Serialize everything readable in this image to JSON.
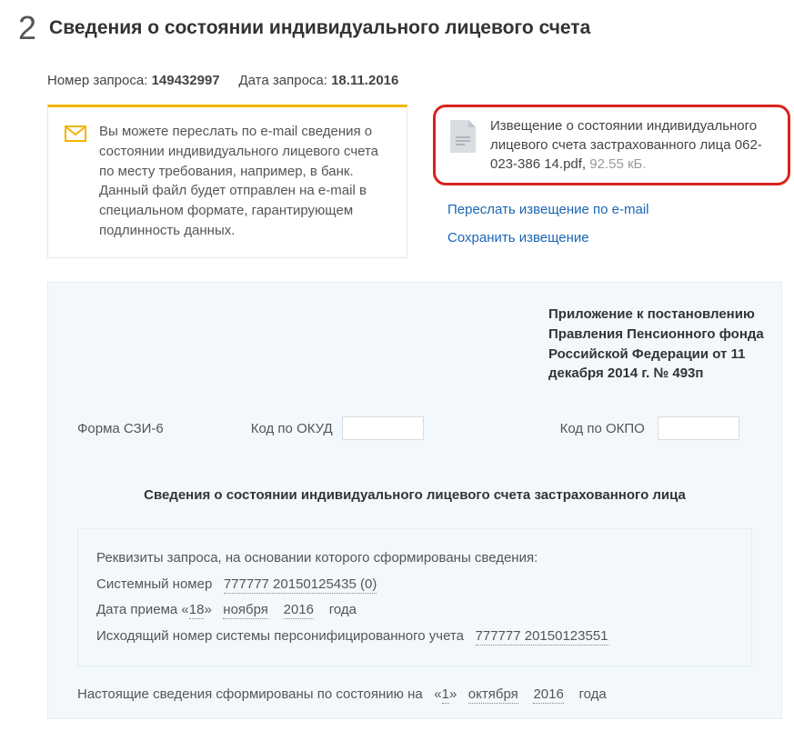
{
  "step_number": "2",
  "title": "Сведения о состоянии индивидуального лицевого счета",
  "meta": {
    "request_number_label": "Номер запроса:",
    "request_number": "149432997",
    "request_date_label": "Дата запроса:",
    "request_date": "18.11.2016"
  },
  "info_card": "Вы можете переслать по e-mail сведения о состоянии индивидуального лицевого счета по месту требования, например, в банк. Данный файл будет отправлен на e-mail в специальном формате, гарантирующем подлинность данных.",
  "file": {
    "title_pre": "Извещение о состоянии индивидуального лицевого счета застрахованного лица 062-023-386 14.pdf",
    "size": "92.55 кБ."
  },
  "links": {
    "forward": "Переслать извещение по e-mail",
    "save": "Сохранить извещение"
  },
  "doc": {
    "regulation": "Приложение к постановлению Правления Пенсионного фонда Российской Федерации от 11 декабря 2014 г. № 493п",
    "form_label": "Форма СЗИ-6",
    "okud_label": "Код по ОКУД",
    "okpo_label": "Код по ОКПО",
    "doc_title": "Сведения о состоянии индивидуального лицевого счета застрахованного лица",
    "req_intro": "Реквизиты запроса, на основании которого сформированы сведения:",
    "sys_num_label": "Системный номер",
    "sys_num": "777777 20150125435 (0)",
    "accept_date_label": "Дата приема",
    "accept_day": "18",
    "accept_month": "ноября",
    "accept_year": "2016",
    "accept_year_suffix": "года",
    "out_num_label": "Исходящий номер системы персонифицированного учета",
    "out_num": "777777 20150123551",
    "status_pre": "Настоящие сведения сформированы по состоянию на",
    "status_day": "1",
    "status_month": "октября",
    "status_year": "2016",
    "status_suffix": "года"
  }
}
